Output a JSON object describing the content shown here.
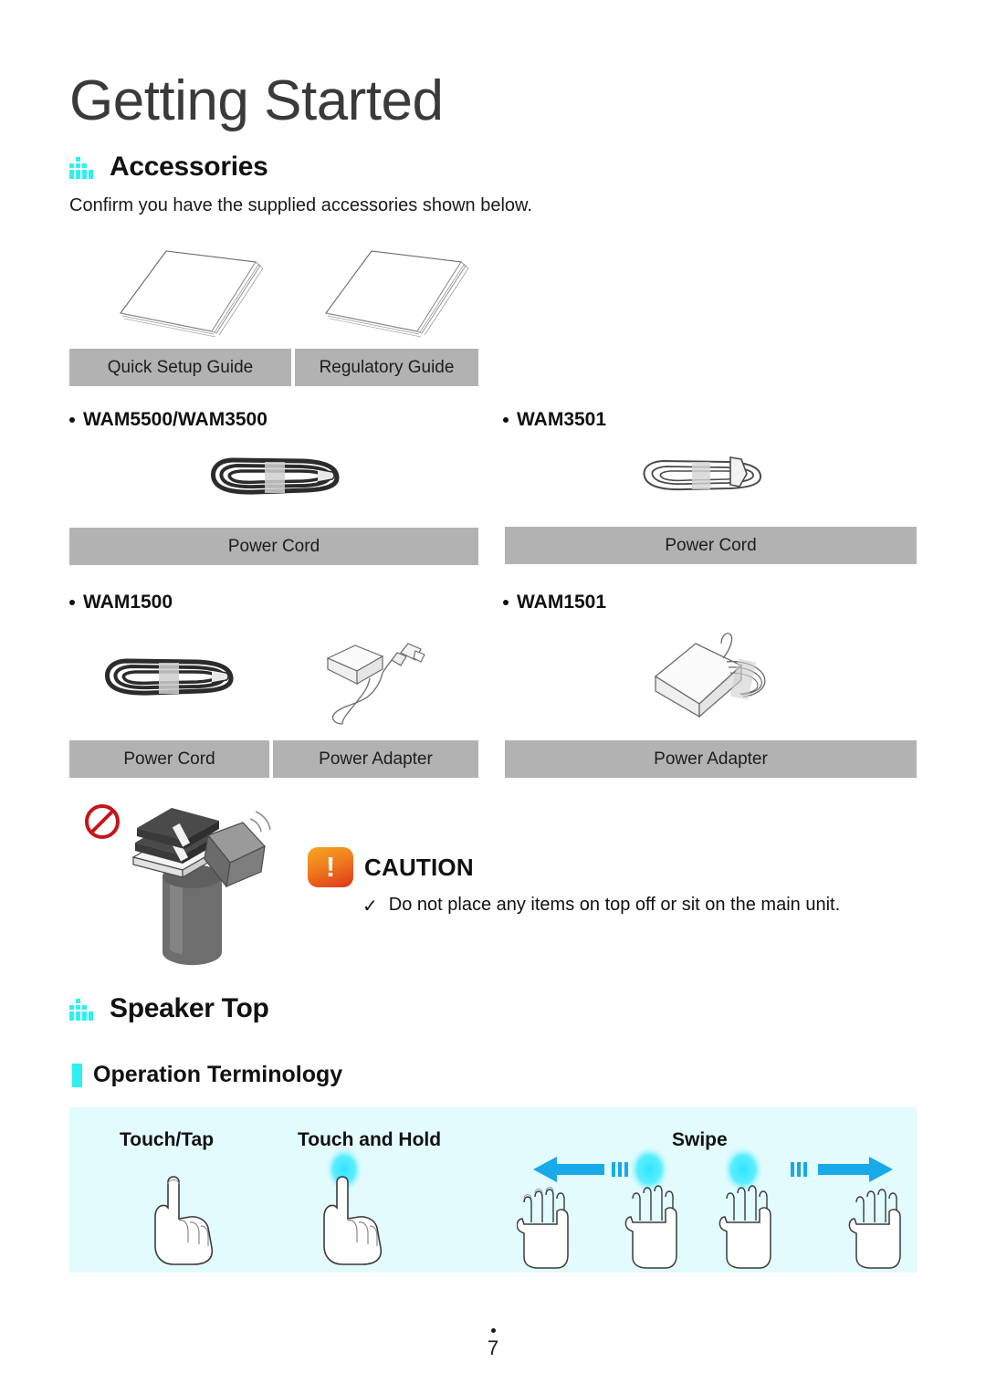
{
  "document": {
    "page_title": "Getting Started",
    "page_number": "7"
  },
  "accessories": {
    "heading": "Accessories",
    "heading_icon": "equalizer-icon",
    "intro": "Confirm you have the supplied accessories shown below.",
    "guides": [
      {
        "caption": "Quick Setup Guide",
        "icon": "booklet-icon"
      },
      {
        "caption": "Regulatory Guide",
        "icon": "booklet-icon"
      }
    ],
    "models": [
      {
        "name": "WAM5500/WAM3500",
        "items": [
          {
            "caption": "Power Cord",
            "icon": "black-power-cord-icon"
          }
        ]
      },
      {
        "name": "WAM3501",
        "items": [
          {
            "caption": "Power Cord",
            "icon": "white-power-cord-icon"
          }
        ]
      },
      {
        "name": "WAM1500",
        "items": [
          {
            "caption": "Power Cord",
            "icon": "black-power-cord-icon"
          },
          {
            "caption": "Power Adapter",
            "icon": "power-adapter-icon"
          }
        ]
      },
      {
        "name": "WAM1501",
        "items": [
          {
            "caption": "Power Adapter",
            "icon": "power-adapter-icon"
          }
        ]
      }
    ]
  },
  "caution": {
    "badge_glyph": "!",
    "title": "CAUTION",
    "tick": "✓",
    "text": "Do not place any items on top off or sit on the main unit.",
    "illustration": "books-on-speaker-prohibited-icon"
  },
  "speaker_top": {
    "heading": "Speaker Top",
    "heading_icon": "equalizer-icon",
    "subheading": "Operation Terminology",
    "gestures": [
      {
        "label": "Touch/Tap",
        "icon": "pointing-hand-icon"
      },
      {
        "label": "Touch and Hold",
        "icon": "pointing-hand-glow-icon"
      },
      {
        "label": "Swipe",
        "icon": "swipe-hands-icon"
      }
    ]
  },
  "colors": {
    "accent_cyan": "#2ff0f0",
    "caption_gray": "#b2b2b2",
    "panel_bg": "#e2fbfd",
    "arrow_blue": "#17a9e8",
    "caution_orange": "#f07c1e"
  }
}
